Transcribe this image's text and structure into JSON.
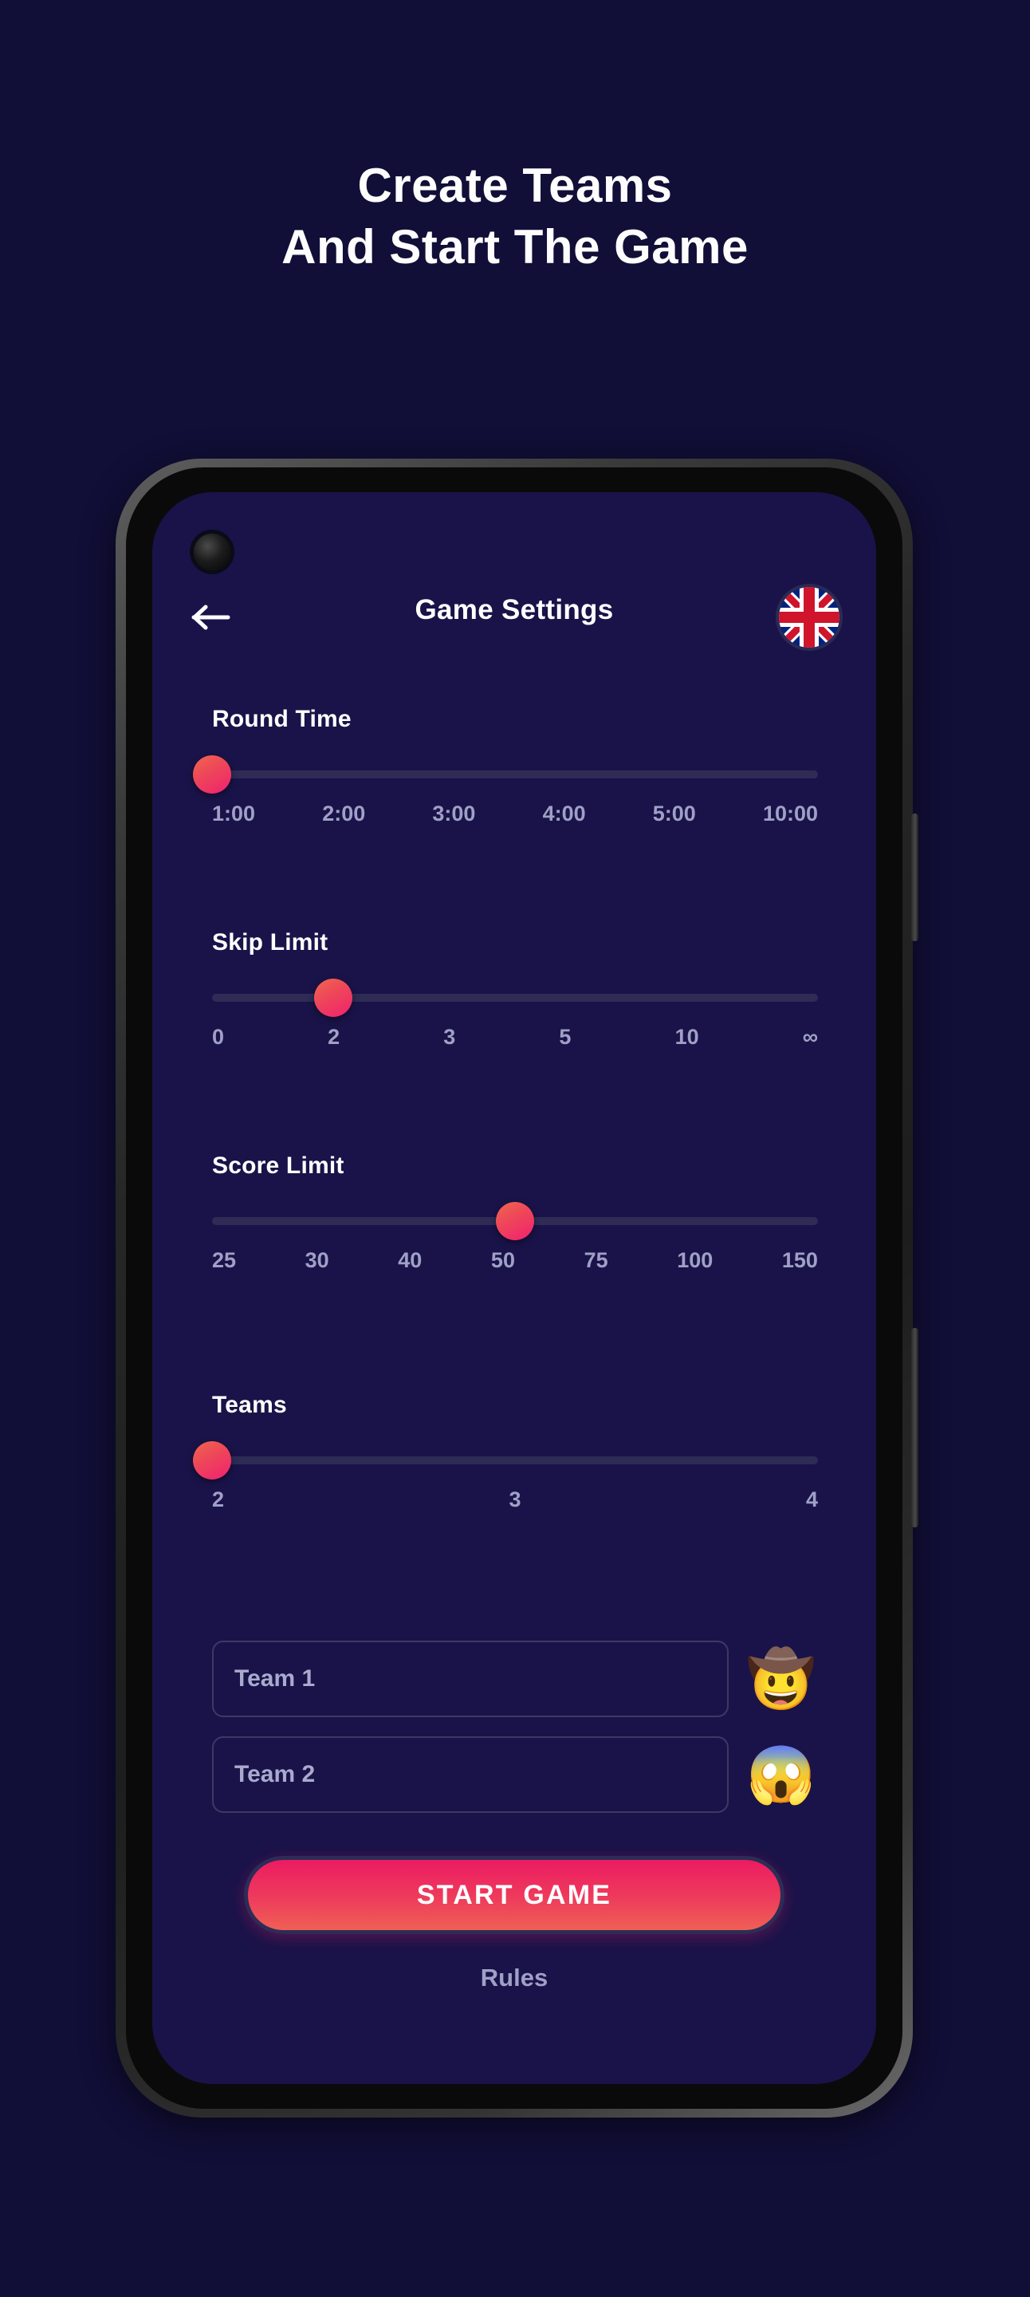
{
  "hero": {
    "line1": "Create Teams",
    "line2": "And Start The Game"
  },
  "app": {
    "header": {
      "title": "Game Settings",
      "back_icon": "arrow-left-icon",
      "language_flag": "united-kingdom-flag-icon"
    },
    "settings": [
      {
        "label": "Round Time",
        "ticks": [
          "1:00",
          "2:00",
          "3:00",
          "4:00",
          "5:00",
          "10:00"
        ],
        "selected": "1:00",
        "thumb_percent": 0
      },
      {
        "label": "Skip Limit",
        "ticks": [
          "0",
          "2",
          "3",
          "5",
          "10",
          "∞"
        ],
        "selected": "2",
        "thumb_percent": 20
      },
      {
        "label": "Score Limit",
        "ticks": [
          "25",
          "30",
          "40",
          "50",
          "75",
          "100",
          "150"
        ],
        "selected": "50",
        "thumb_percent": 50
      },
      {
        "label": "Teams",
        "ticks": [
          "2",
          "3",
          "4"
        ],
        "selected": "2",
        "thumb_percent": 0
      }
    ],
    "teams": [
      {
        "placeholder": "Team 1",
        "value": "",
        "emoji": "🤠",
        "emoji_name": "cowboy-hat-face-emoji"
      },
      {
        "placeholder": "Team 2",
        "value": "",
        "emoji": "😱",
        "emoji_name": "screaming-face-emoji"
      }
    ],
    "start_button": "START GAME",
    "rules_link": "Rules"
  },
  "colors": {
    "page_background": "#110E37",
    "screen_background": "#1A1349",
    "accent_pink": "#EC1B62",
    "accent_coral": "#EF6055",
    "track": "#2E2C55",
    "muted_text": "#9FA0C6",
    "input_border": "#3B3A64"
  }
}
